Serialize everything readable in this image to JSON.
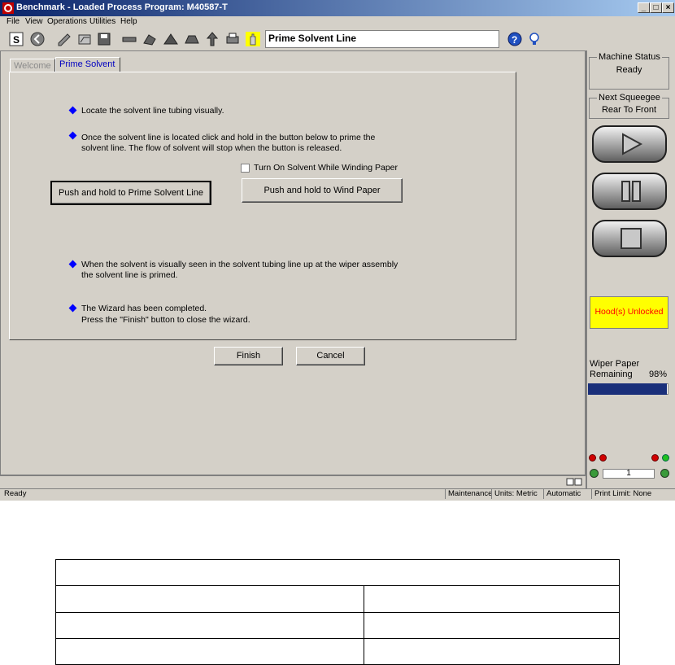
{
  "window": {
    "title": "Benchmark - Loaded Process Program: M40587-T"
  },
  "menu": [
    "File",
    "View",
    "Operations",
    "Utilities",
    "Help"
  ],
  "toolbar": {
    "title_field": "Prime Solvent Line"
  },
  "tabs": [
    "Welcome",
    "Prime Solvent"
  ],
  "wizard": {
    "step1": "Locate the solvent line tubing visually.",
    "step2_line1": "Once the solvent line is located click and hold in the button below to prime the",
    "step2_line2": "solvent line.  The flow of solvent will stop when the button is released.",
    "checkbox_label": "Turn On Solvent While Winding Paper",
    "prime_button": "Push and hold to Prime Solvent Line",
    "wind_button": "Push and hold to Wind Paper",
    "step3_line1": "When the solvent is visually seen in the solvent tubing line up at the wiper assembly",
    "step3_line2": "the solvent line is primed.",
    "step4_line1": "The Wizard has been completed.",
    "step4_line2": "Press the \"Finish\" button to close the wizard.",
    "finish_button": "Finish",
    "cancel_button": "Cancel"
  },
  "side_panel": {
    "machine_status_label": "Machine Status",
    "machine_status_value": "Ready",
    "next_squeegee_label": "Next Squeegee",
    "next_squeegee_value": "Rear To Front",
    "hood_status": "Hood(s) Unlocked",
    "wiper_paper_label1": "Wiper Paper",
    "wiper_paper_label2": "Remaining",
    "wiper_paper_percent": "98%",
    "wiper_paper_fraction": 0.98,
    "counter": "1"
  },
  "status_bar": {
    "left": "Ready",
    "mode": "Maintenance",
    "units": "Units: Metric",
    "run_mode": "Automatic",
    "print_limit": "Print Limit: None"
  },
  "colors": {
    "title_bar": "#0a246a",
    "hood_bg": "#ffff00",
    "hood_text": "#ff0000",
    "progress": "#1a2f7a",
    "bullet": "#0000ff"
  }
}
